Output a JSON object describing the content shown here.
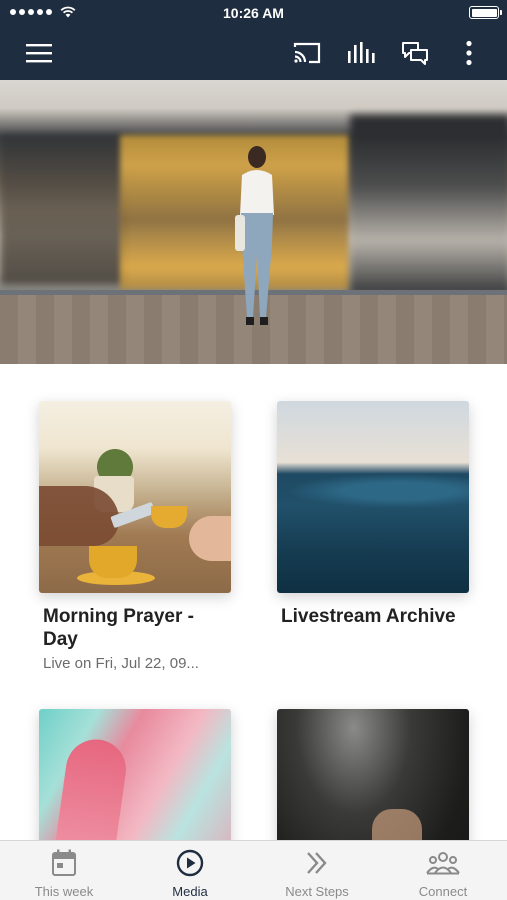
{
  "status_bar": {
    "time": "10:26 AM"
  },
  "app_bar": {
    "icons": [
      "menu-icon",
      "cast-icon",
      "equalizer-icon",
      "chat-icon",
      "more-vertical-icon"
    ],
    "color": "#1f2d40"
  },
  "cards": [
    {
      "title": "Morning Prayer - Day",
      "subtitle": "Live on Fri, Jul 22, 09...",
      "image": "coffee-cups-table"
    },
    {
      "title": "Livestream Archive",
      "subtitle": "",
      "image": "ocean-wave"
    },
    {
      "title": "",
      "subtitle": "",
      "image": "pink-teal-paint"
    },
    {
      "title": "",
      "subtitle": "",
      "image": "dark-raised-hands"
    }
  ],
  "tab_bar": {
    "tabs": [
      {
        "label": "This week",
        "icon": "calendar-icon",
        "active": false
      },
      {
        "label": "Media",
        "icon": "play-circle-icon",
        "active": true
      },
      {
        "label": "Next Steps",
        "icon": "double-chevron-right-icon",
        "active": false
      },
      {
        "label": "Connect",
        "icon": "group-icon",
        "active": false
      }
    ],
    "active_color": "#1f2d40",
    "inactive_color": "#8a8a8a"
  }
}
